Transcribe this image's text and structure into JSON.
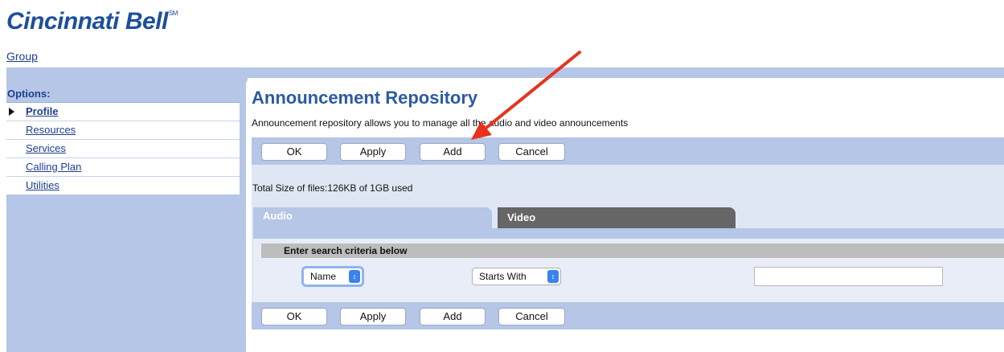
{
  "header": {
    "logo_text": "Cincinnati Bell",
    "logo_mark": "SM",
    "group_link": "Group"
  },
  "sidebar": {
    "title": "Options:",
    "items": [
      {
        "label": "Profile",
        "active": true
      },
      {
        "label": "Resources"
      },
      {
        "label": "Services"
      },
      {
        "label": "Calling Plan"
      },
      {
        "label": "Utilities"
      }
    ]
  },
  "main": {
    "title": "Announcement Repository",
    "description": "Announcement repository allows you to manage all the audio and video announcements",
    "buttons": {
      "ok": "OK",
      "apply": "Apply",
      "add": "Add",
      "cancel": "Cancel"
    },
    "total_size": "Total Size of files:126KB of 1GB used",
    "tabs": {
      "audio": "Audio",
      "video": "Video"
    },
    "search": {
      "header": "Enter search criteria below",
      "field_select": "Name",
      "mode_select": "Starts With",
      "value": ""
    }
  },
  "colors": {
    "brand_blue": "#1d4f9c",
    "panel_blue": "#b5c6e6",
    "annotation_arrow": "#e8321e"
  },
  "annotation": {
    "type": "arrow",
    "target": "top-add-button"
  }
}
